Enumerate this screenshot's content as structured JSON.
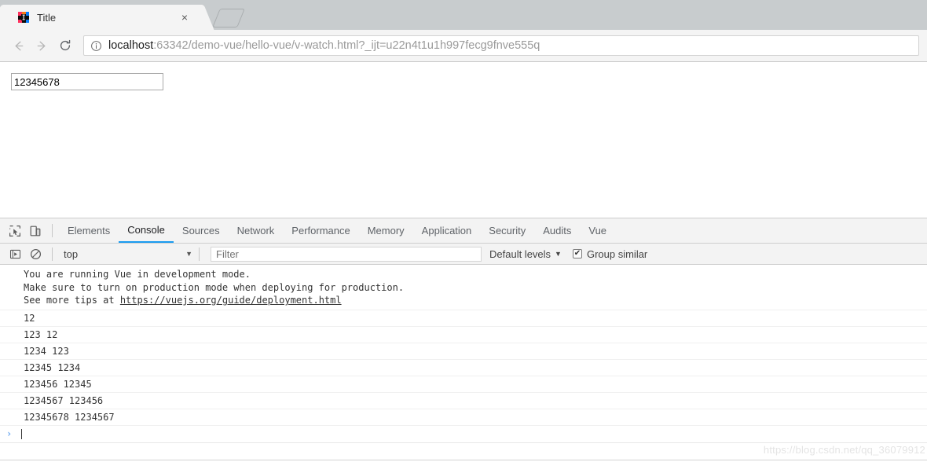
{
  "browser": {
    "tab": {
      "title": "Title",
      "favicon": "intellij-idea-icon",
      "close_label": "×"
    },
    "newtab_label": "",
    "nav": {
      "back_icon": "arrow-left-icon",
      "forward_icon": "arrow-right-icon",
      "reload_icon": "reload-icon",
      "info_icon": "page-info-icon"
    },
    "url": {
      "host": "localhost",
      "rest": ":63342/demo-vue/hello-vue/v-watch.html?_ijt=u22n4t1u1h997fecg9fnve555q",
      "full": "localhost:63342/demo-vue/hello-vue/v-watch.html?_ijt=u22n4t1u1h997fecg9fnve555q"
    }
  },
  "page": {
    "input_value": "12345678",
    "input_placeholder": ""
  },
  "devtools": {
    "left_icons": [
      {
        "name": "inspect-element-icon"
      },
      {
        "name": "device-toolbar-icon"
      }
    ],
    "tabs": [
      {
        "label": "Elements",
        "selected": false
      },
      {
        "label": "Console",
        "selected": true
      },
      {
        "label": "Sources",
        "selected": false
      },
      {
        "label": "Network",
        "selected": false
      },
      {
        "label": "Performance",
        "selected": false
      },
      {
        "label": "Memory",
        "selected": false
      },
      {
        "label": "Application",
        "selected": false
      },
      {
        "label": "Security",
        "selected": false
      },
      {
        "label": "Audits",
        "selected": false
      },
      {
        "label": "Vue",
        "selected": false
      }
    ],
    "toolbar": {
      "execute_icon": "execution-context-icon",
      "clear_icon": "clear-console-icon",
      "context_value": "top",
      "caret": "▼",
      "filter_placeholder": "Filter",
      "filter_value": "",
      "levels_label": "Default levels",
      "group_similar_label": "Group similar",
      "group_similar_checked": true,
      "checkmark": "✔"
    },
    "console": {
      "banner_lines": [
        "You are running Vue in development mode.",
        "Make sure to turn on production mode when deploying for production."
      ],
      "banner_tail_prefix": "See more tips at ",
      "banner_link": "https://vuejs.org/guide/deployment.html",
      "logs": [
        "12",
        "123 12",
        "1234 123",
        "12345 1234",
        "123456 12345",
        "1234567 123456",
        "12345678 1234567"
      ],
      "prompt_caret": "›"
    },
    "watermark": "https://blog.csdn.net/qq_36079912"
  },
  "colors": {
    "accent": "#1a9bf0",
    "chrome_tabstrip": "#c8ccce",
    "toolbar_bg": "#f4f4f4",
    "devtools_bg": "#f3f3f3",
    "prompt_blue": "#6aa7f0"
  }
}
